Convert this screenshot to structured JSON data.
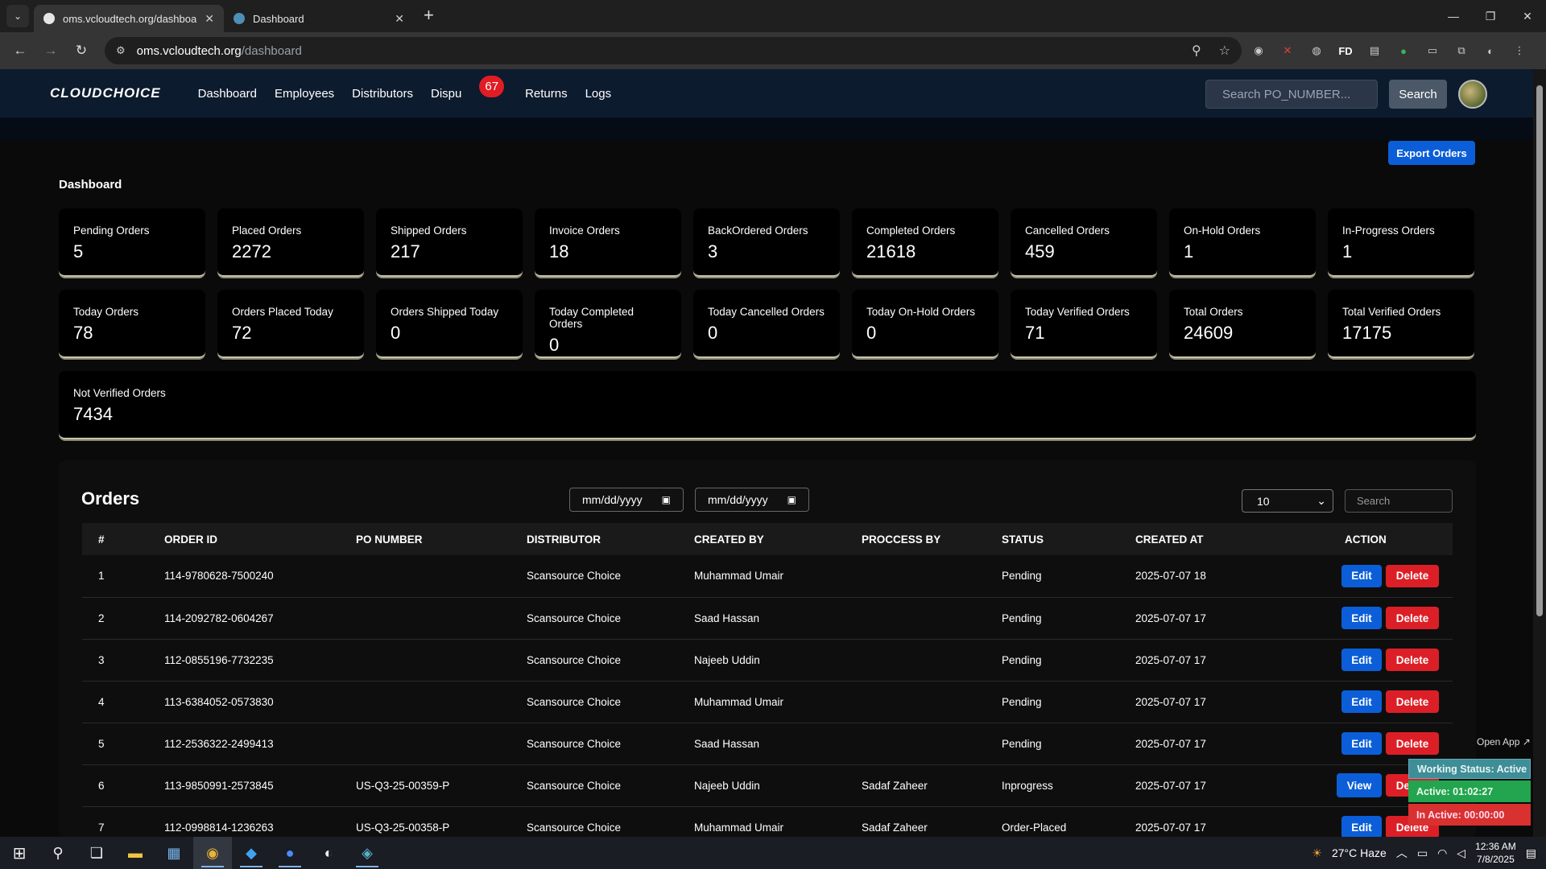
{
  "browser": {
    "tabs": [
      {
        "title": "oms.vcloudtech.org/dashboard",
        "active": true
      },
      {
        "title": "Dashboard",
        "active": false
      }
    ],
    "url_host": "oms.vcloudtech.org",
    "url_path": "/dashboard",
    "ext_fd_label": "FD"
  },
  "app": {
    "logo": "CLOUDCHOICE",
    "nav": [
      "Dashboard",
      "Employees",
      "Distributors",
      "Dispu",
      "Returns",
      "Logs"
    ],
    "disputes_badge": "67",
    "search_placeholder": "Search PO_NUMBER...",
    "search_button": "Search",
    "export_button": "Export Orders",
    "page_title": "Dashboard"
  },
  "stats": [
    {
      "label": "Pending Orders",
      "value": "5"
    },
    {
      "label": "Placed Orders",
      "value": "2272"
    },
    {
      "label": "Shipped Orders",
      "value": "217"
    },
    {
      "label": "Invoice Orders",
      "value": "18"
    },
    {
      "label": "BackOrdered Orders",
      "value": "3"
    },
    {
      "label": "Completed Orders",
      "value": "21618"
    },
    {
      "label": "Cancelled Orders",
      "value": "459"
    },
    {
      "label": "On-Hold Orders",
      "value": "1"
    },
    {
      "label": "In-Progress Orders",
      "value": "1"
    },
    {
      "label": "Today Orders",
      "value": "78"
    },
    {
      "label": "Orders Placed Today",
      "value": "72"
    },
    {
      "label": "Orders Shipped Today",
      "value": "0"
    },
    {
      "label": "Today Completed Orders",
      "value": "0"
    },
    {
      "label": "Today Cancelled Orders",
      "value": "0"
    },
    {
      "label": "Today On-Hold Orders",
      "value": "0"
    },
    {
      "label": "Today Verified Orders",
      "value": "71"
    },
    {
      "label": "Total Orders",
      "value": "24609"
    },
    {
      "label": "Total Verified Orders",
      "value": "17175"
    },
    {
      "label": "Not Verified Orders",
      "value": "7434"
    }
  ],
  "orders": {
    "title": "Orders",
    "date_placeholder": "mm/dd/yyyy",
    "per_page": "10",
    "search_placeholder": "Search",
    "columns": [
      "#",
      "ORDER ID",
      "PO NUMBER",
      "DISTRIBUTOR",
      "CREATED BY",
      "PROCCESS BY",
      "STATUS",
      "CREATED AT",
      "ACTION"
    ],
    "edit_label": "Edit",
    "view_label": "View",
    "delete_label": "Delete",
    "rows": [
      {
        "n": "1",
        "order_id": "114-9780628-7500240",
        "po": "",
        "distributor": "Scansource Choice",
        "created_by": "Muhammad Umair",
        "processed_by": "",
        "status": "Pending",
        "created_at": "2025-07-07 18",
        "primary": "Edit"
      },
      {
        "n": "2",
        "order_id": "114-2092782-0604267",
        "po": "",
        "distributor": "Scansource Choice",
        "created_by": "Saad Hassan",
        "processed_by": "",
        "status": "Pending",
        "created_at": "2025-07-07 17",
        "primary": "Edit"
      },
      {
        "n": "3",
        "order_id": "112-0855196-7732235",
        "po": "",
        "distributor": "Scansource Choice",
        "created_by": "Najeeb Uddin",
        "processed_by": "",
        "status": "Pending",
        "created_at": "2025-07-07 17",
        "primary": "Edit"
      },
      {
        "n": "4",
        "order_id": "113-6384052-0573830",
        "po": "",
        "distributor": "Scansource Choice",
        "created_by": "Muhammad Umair",
        "processed_by": "",
        "status": "Pending",
        "created_at": "2025-07-07 17",
        "primary": "Edit"
      },
      {
        "n": "5",
        "order_id": "112-2536322-2499413",
        "po": "",
        "distributor": "Scansource Choice",
        "created_by": "Saad Hassan",
        "processed_by": "",
        "status": "Pending",
        "created_at": "2025-07-07 17",
        "primary": "Edit"
      },
      {
        "n": "6",
        "order_id": "113-9850991-2573845",
        "po": "US-Q3-25-00359-P",
        "distributor": "Scansource Choice",
        "created_by": "Najeeb Uddin",
        "processed_by": "Sadaf Zaheer",
        "status": "Inprogress",
        "created_at": "2025-07-07 17",
        "primary": "View"
      },
      {
        "n": "7",
        "order_id": "112-0998814-1236263",
        "po": "US-Q3-25-00358-P",
        "distributor": "Scansource Choice",
        "created_by": "Muhammad Umair",
        "processed_by": "Sadaf Zaheer",
        "status": "Order-Placed",
        "created_at": "2025-07-07 17",
        "primary": "Edit"
      }
    ]
  },
  "widget": {
    "open_app": "Open App ↗",
    "working_status": "Working Status: Active",
    "active": "Active: 01:02:27",
    "inactive": "In Active: 00:00:00"
  },
  "taskbar": {
    "weather": "27°C  Haze",
    "time": "12:36 AM",
    "date": "7/8/2025"
  }
}
